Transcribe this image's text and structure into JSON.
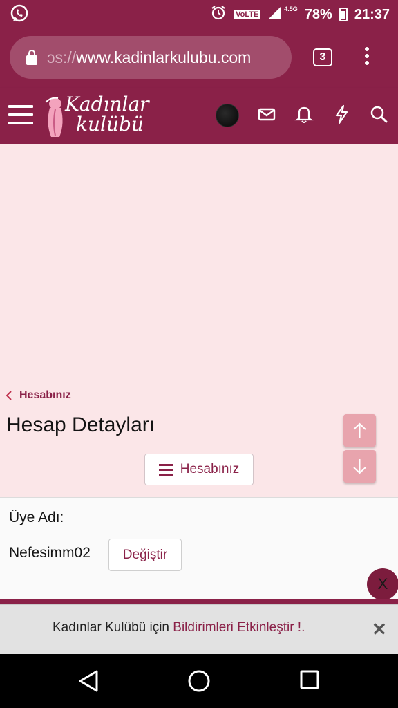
{
  "status_bar": {
    "volte": "VoLTE",
    "network": "4.5G",
    "battery": "78%",
    "time": "21:37"
  },
  "browser": {
    "url_prefix": "ɔs://",
    "url": "www.kadinlarkulubu.com",
    "tab_count": "3"
  },
  "site": {
    "logo_line1": "Kadınlar",
    "logo_line2": "kulübü",
    "accent_color": "#8a2148",
    "background_color": "#fbe6e8"
  },
  "page": {
    "breadcrumb": "Hesabınız",
    "title": "Hesap Detayları",
    "menu_button": "Hesabınız"
  },
  "account": {
    "username_label": "Üye Adı:",
    "username": "Nefesimm02",
    "change_button": "Değiştir"
  },
  "floating": {
    "close_label": "X"
  },
  "notification": {
    "text_before": "Kadınlar Kulübü için ",
    "link_text": "Bildirimleri Etkinleştir !",
    "text_after": ".",
    "close": "✕"
  },
  "icons": {
    "header": [
      "avatar",
      "envelope-icon",
      "bell-icon",
      "bolt-icon",
      "search-icon"
    ],
    "nav": [
      "back-icon",
      "home-icon",
      "recents-icon"
    ]
  }
}
